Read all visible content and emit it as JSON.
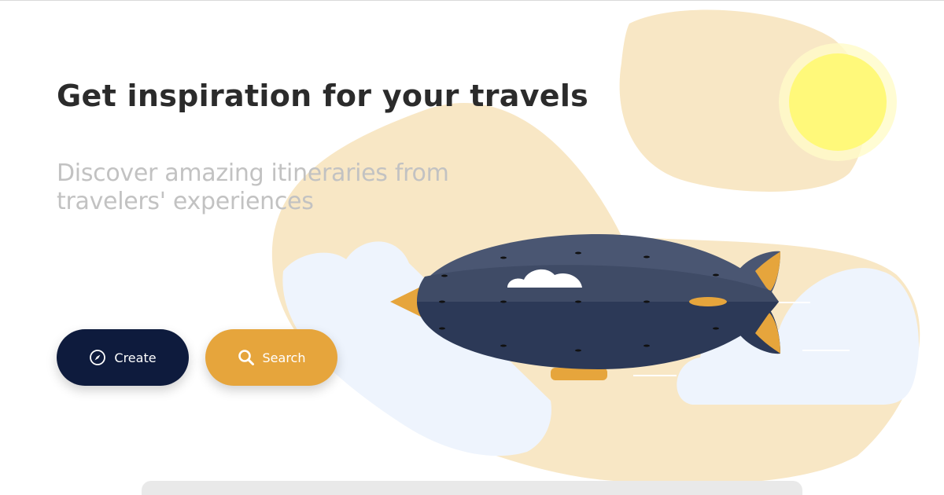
{
  "hero": {
    "title": "Get inspiration for your travels",
    "subtitle": "Discover amazing itineraries from travelers' experiences"
  },
  "actions": {
    "create_label": "Create",
    "create_icon": "compass-icon",
    "search_label": "Search",
    "search_icon": "search-icon"
  },
  "colors": {
    "navy": "#0e1b3d",
    "accent": "#e6a53c",
    "blob": "#f8e7c5",
    "sun": "#fff97a",
    "cloud": "#eef4fd",
    "airship": "#4a5672"
  }
}
